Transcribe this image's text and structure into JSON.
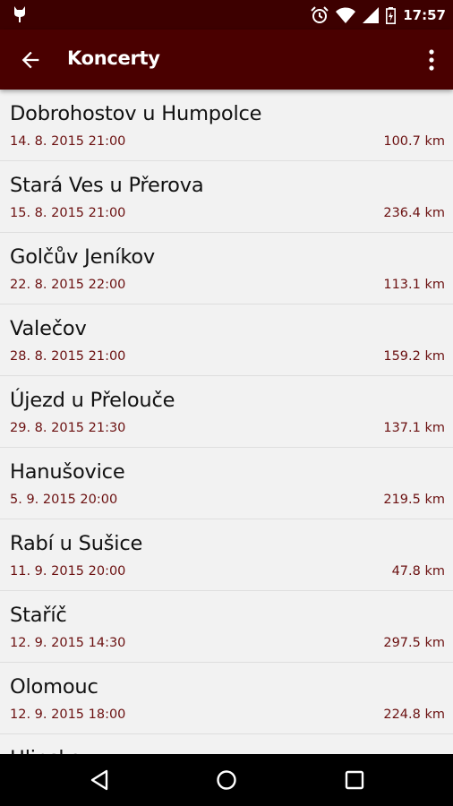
{
  "status_bar": {
    "time": "17:57",
    "icons": [
      "cat-notification-icon",
      "alarm-icon",
      "wifi-icon",
      "signal-icon",
      "battery-icon"
    ]
  },
  "app_bar": {
    "title": "Koncerty",
    "back_icon": "arrow-back-icon",
    "menu_icon": "more-vert-icon"
  },
  "concerts": [
    {
      "name": "Dobrohostov u Humpolce",
      "date": "14. 8. 2015 21:00",
      "distance": "100.7 km"
    },
    {
      "name": "Stará Ves u Přerova",
      "date": "15. 8. 2015 21:00",
      "distance": "236.4 km"
    },
    {
      "name": "Golčův Jeníkov",
      "date": "22. 8. 2015 22:00",
      "distance": "113.1 km"
    },
    {
      "name": "Valečov",
      "date": "28. 8. 2015 21:00",
      "distance": "159.2 km"
    },
    {
      "name": "Újezd u Přelouče",
      "date": "29. 8. 2015 21:30",
      "distance": "137.1 km"
    },
    {
      "name": "Hanušovice",
      "date": "5. 9. 2015 20:00",
      "distance": "219.5 km"
    },
    {
      "name": "Rabí u Sušice",
      "date": "11. 9. 2015 20:00",
      "distance": "47.8 km"
    },
    {
      "name": "Staříč",
      "date": "12. 9. 2015 14:30",
      "distance": "297.5 km"
    },
    {
      "name": "Olomouc",
      "date": "12. 9. 2015 18:00",
      "distance": "224.8 km"
    },
    {
      "name": "Hlinsko",
      "date": "",
      "distance": ""
    }
  ],
  "colors": {
    "status_bar": "#3d0000",
    "app_bar": "#4a0000",
    "accent_text": "#6b1010",
    "background": "#f2f2f2"
  },
  "nav_bar": {
    "icons": [
      "nav-back-icon",
      "nav-home-icon",
      "nav-recents-icon"
    ]
  }
}
